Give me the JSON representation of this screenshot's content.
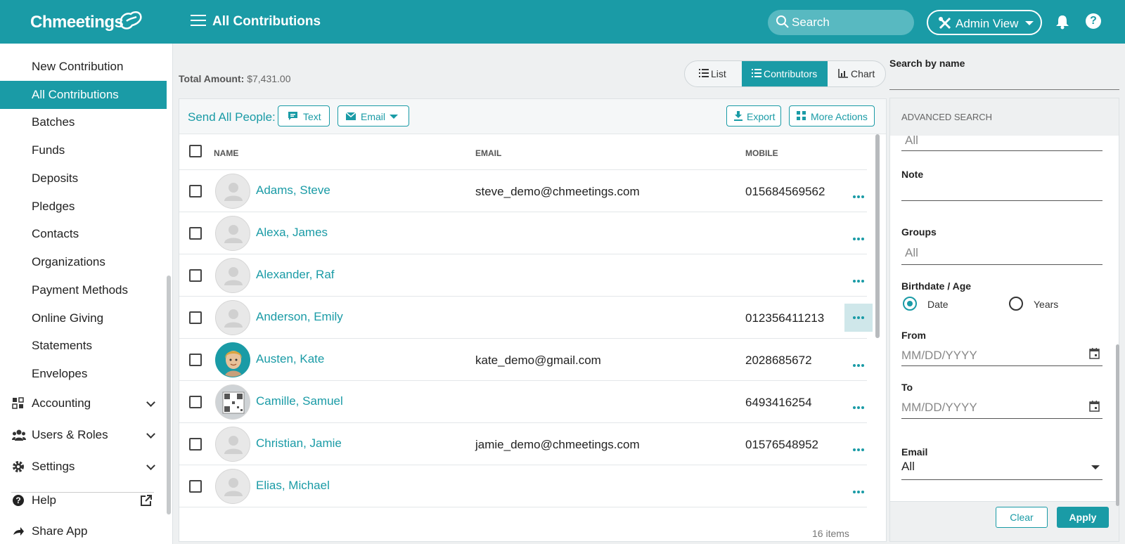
{
  "header": {
    "logo_text": "Chmeetings",
    "page_title": "All Contributions",
    "search_placeholder": "Search",
    "admin_view_label": "Admin View",
    "help_label": "?"
  },
  "sidebar": {
    "items": [
      {
        "label": "New Contribution"
      },
      {
        "label": "All Contributions",
        "active": true
      },
      {
        "label": "Batches"
      },
      {
        "label": "Funds"
      },
      {
        "label": "Deposits"
      },
      {
        "label": "Pledges"
      },
      {
        "label": "Contacts"
      },
      {
        "label": "Organizations"
      },
      {
        "label": "Payment Methods"
      },
      {
        "label": "Online Giving"
      },
      {
        "label": "Statements"
      },
      {
        "label": "Envelopes"
      }
    ],
    "groups": [
      {
        "label": "Accounting",
        "icon": "accounting-icon"
      },
      {
        "label": "Users & Roles",
        "icon": "users-icon"
      },
      {
        "label": "Settings",
        "icon": "gear-icon"
      }
    ],
    "help_label": "Help",
    "share_label": "Share App"
  },
  "toolbar": {
    "total_label": "Total Amount:",
    "total_value": "$7,431.00",
    "views": [
      "List",
      "Contributors",
      "Chart"
    ],
    "active_view": "Contributors",
    "send_label": "Send All People:",
    "text_btn": "Text",
    "email_btn": "Email",
    "export_btn": "Export",
    "more_actions_btn": "More Actions"
  },
  "table": {
    "columns": [
      "NAME",
      "EMAIL",
      "MOBILE"
    ],
    "rows": [
      {
        "name": "Adams, Steve",
        "email": "steve_demo@chmeetings.com",
        "mobile": "015684569562",
        "avatar": "placeholder"
      },
      {
        "name": "Alexa, James",
        "email": "",
        "mobile": "",
        "avatar": "placeholder"
      },
      {
        "name": "Alexander, Raf",
        "email": "",
        "mobile": "",
        "avatar": "placeholder"
      },
      {
        "name": "Anderson, Emily",
        "email": "",
        "mobile": "012356411213",
        "avatar": "placeholder",
        "highlight": true
      },
      {
        "name": "Austen, Kate",
        "email": "kate_demo@gmail.com",
        "mobile": "2028685672",
        "avatar": "photo-woman"
      },
      {
        "name": "Camille, Samuel",
        "email": "",
        "mobile": "6493416254",
        "avatar": "photo-qr"
      },
      {
        "name": "Christian, Jamie",
        "email": "jamie_demo@chmeetings.com",
        "mobile": "01576548952",
        "avatar": "placeholder"
      },
      {
        "name": "Elias, Michael",
        "email": "",
        "mobile": "",
        "avatar": "placeholder"
      }
    ],
    "items_count": "16 items"
  },
  "advanced": {
    "search_by_name_label": "Search by name",
    "title": "ADVANCED SEARCH",
    "top_value": "All",
    "note_label": "Note",
    "groups_label": "Groups",
    "groups_value": "All",
    "birthdate_label": "Birthdate / Age",
    "radio_date": "Date",
    "radio_years": "Years",
    "from_label": "From",
    "from_placeholder": "MM/DD/YYYY",
    "to_label": "To",
    "to_placeholder": "MM/DD/YYYY",
    "email_label": "Email",
    "email_value": "All",
    "clear_btn": "Clear",
    "apply_btn": "Apply"
  },
  "colors": {
    "accent": "#1a9ba6",
    "highlight": "#cfe7ea"
  }
}
